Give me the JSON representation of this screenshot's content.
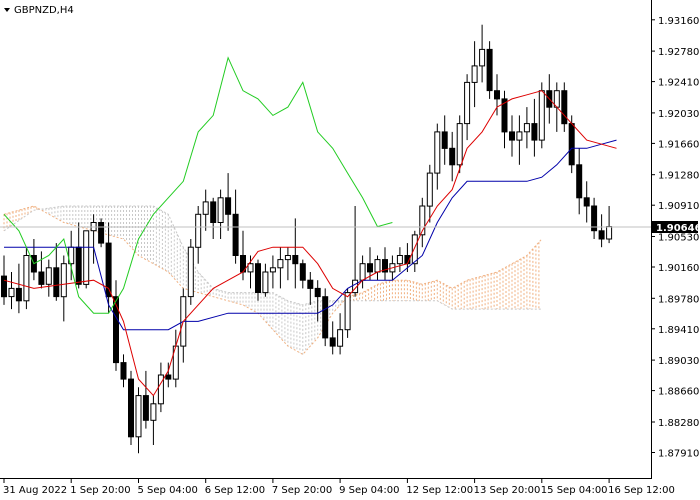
{
  "chart_data": {
    "type": "candlestick",
    "symbol_label": "GBPNZD,H4",
    "current_price_label": "1.90646",
    "current_price": 1.90646,
    "ylim": [
      1.876,
      1.934
    ],
    "y_ticks": [
      "1.93160",
      "1.92780",
      "1.92410",
      "1.92030",
      "1.91660",
      "1.91280",
      "1.90910",
      "1.90530",
      "1.90160",
      "1.89780",
      "1.89410",
      "1.89030",
      "1.88660",
      "1.88280",
      "1.87910"
    ],
    "x_ticks": [
      {
        "label": "31 Aug 2022",
        "index": 0
      },
      {
        "label": "1 Sep 20:00",
        "index": 9
      },
      {
        "label": "5 Sep 04:00",
        "index": 18
      },
      {
        "label": "6 Sep 12:00",
        "index": 27
      },
      {
        "label": "7 Sep 20:00",
        "index": 36
      },
      {
        "label": "9 Sep 04:00",
        "index": 45
      },
      {
        "label": "12 Sep 12:00",
        "index": 54
      },
      {
        "label": "13 Sep 20:00",
        "index": 63
      },
      {
        "label": "15 Sep 04:00",
        "index": 72
      },
      {
        "label": "16 Sep 12:00",
        "index": 81
      }
    ],
    "colors": {
      "bull": "#ffffff",
      "bear": "#000000",
      "tenkan": "#dd0000",
      "kijun": "#0000aa",
      "chikou": "#22cc22",
      "cloud_a": "#c8c8c8",
      "cloud_b": "#f0b080",
      "price_line": "#c0c0c0",
      "price_tag_bg": "#000000"
    },
    "candles": [
      [
        1.9005,
        1.903,
        1.897,
        1.898
      ],
      [
        1.898,
        1.901,
        1.8965,
        1.899
      ],
      [
        1.899,
        1.902,
        1.896,
        1.8975
      ],
      [
        1.8975,
        1.904,
        1.8965,
        1.903
      ],
      [
        1.903,
        1.905,
        1.9,
        1.901
      ],
      [
        1.901,
        1.9035,
        1.899,
        1.8995
      ],
      [
        1.8995,
        1.9025,
        1.898,
        1.9015
      ],
      [
        1.9015,
        1.9045,
        1.8975,
        1.898
      ],
      [
        1.898,
        1.903,
        1.895,
        1.902
      ],
      [
        1.902,
        1.906,
        1.9,
        1.904
      ],
      [
        1.904,
        1.907,
        1.899,
        1.8995
      ],
      [
        1.8995,
        1.906,
        1.899,
        1.906
      ],
      [
        1.906,
        1.908,
        1.902,
        1.907
      ],
      [
        1.907,
        1.9075,
        1.904,
        1.9045
      ],
      [
        1.9045,
        1.907,
        1.896,
        1.898
      ],
      [
        1.898,
        1.9,
        1.889,
        1.89
      ],
      [
        1.89,
        1.891,
        1.887,
        1.888
      ],
      [
        1.888,
        1.889,
        1.88,
        1.881
      ],
      [
        1.881,
        1.887,
        1.879,
        1.886
      ],
      [
        1.886,
        1.889,
        1.882,
        1.883
      ],
      [
        1.883,
        1.886,
        1.88,
        1.885
      ],
      [
        1.885,
        1.89,
        1.884,
        1.8885
      ],
      [
        1.8885,
        1.89,
        1.887,
        1.888
      ],
      [
        1.888,
        1.894,
        1.887,
        1.892
      ],
      [
        1.892,
        1.899,
        1.89,
        1.898
      ],
      [
        1.898,
        1.905,
        1.897,
        1.904
      ],
      [
        1.904,
        1.909,
        1.902,
        1.908
      ],
      [
        1.908,
        1.911,
        1.906,
        1.9095
      ],
      [
        1.9095,
        1.91,
        1.905,
        1.907
      ],
      [
        1.907,
        1.911,
        1.905,
        1.91
      ],
      [
        1.91,
        1.913,
        1.906,
        1.908
      ],
      [
        1.908,
        1.911,
        1.902,
        1.903
      ],
      [
        1.903,
        1.906,
        1.9,
        1.901
      ],
      [
        1.901,
        1.903,
        1.899,
        1.902
      ],
      [
        1.902,
        1.9025,
        1.8975,
        1.8985
      ],
      [
        1.8985,
        1.902,
        1.898,
        1.901
      ],
      [
        1.901,
        1.903,
        1.899,
        1.9015
      ],
      [
        1.9015,
        1.904,
        1.899,
        1.9025
      ],
      [
        1.9025,
        1.904,
        1.9,
        1.903
      ],
      [
        1.903,
        1.9075,
        1.899,
        1.902
      ],
      [
        1.902,
        1.9025,
        1.899,
        1.9
      ],
      [
        1.9,
        1.901,
        1.897,
        1.899
      ],
      [
        1.899,
        1.9,
        1.895,
        1.898
      ],
      [
        1.898,
        1.899,
        1.892,
        1.893
      ],
      [
        1.893,
        1.895,
        1.891,
        1.892
      ],
      [
        1.892,
        1.896,
        1.891,
        1.894
      ],
      [
        1.894,
        1.899,
        1.893,
        1.8985
      ],
      [
        1.8985,
        1.909,
        1.898,
        1.9
      ],
      [
        1.9,
        1.903,
        1.899,
        1.902
      ],
      [
        1.902,
        1.904,
        1.9,
        1.901
      ],
      [
        1.901,
        1.903,
        1.9,
        1.9025
      ],
      [
        1.9025,
        1.904,
        1.9,
        1.901
      ],
      [
        1.901,
        1.903,
        1.9,
        1.902
      ],
      [
        1.902,
        1.904,
        1.901,
        1.903
      ],
      [
        1.903,
        1.9045,
        1.901,
        1.902
      ],
      [
        1.902,
        1.906,
        1.901,
        1.9055
      ],
      [
        1.9055,
        1.91,
        1.904,
        1.909
      ],
      [
        1.909,
        1.914,
        1.907,
        1.913
      ],
      [
        1.913,
        1.919,
        1.911,
        1.918
      ],
      [
        1.918,
        1.92,
        1.914,
        1.916
      ],
      [
        1.916,
        1.918,
        1.912,
        1.914
      ],
      [
        1.914,
        1.92,
        1.913,
        1.919
      ],
      [
        1.919,
        1.925,
        1.917,
        1.924
      ],
      [
        1.924,
        1.929,
        1.921,
        1.926
      ],
      [
        1.926,
        1.931,
        1.924,
        1.928
      ],
      [
        1.928,
        1.929,
        1.922,
        1.923
      ],
      [
        1.923,
        1.925,
        1.92,
        1.922
      ],
      [
        1.922,
        1.923,
        1.916,
        1.918
      ],
      [
        1.918,
        1.92,
        1.915,
        1.917
      ],
      [
        1.917,
        1.92,
        1.914,
        1.918
      ],
      [
        1.918,
        1.921,
        1.916,
        1.919
      ],
      [
        1.919,
        1.922,
        1.915,
        1.917
      ],
      [
        1.917,
        1.924,
        1.916,
        1.923
      ],
      [
        1.923,
        1.925,
        1.919,
        1.921
      ],
      [
        1.921,
        1.924,
        1.918,
        1.923
      ],
      [
        1.923,
        1.924,
        1.918,
        1.919
      ],
      [
        1.919,
        1.92,
        1.913,
        1.914
      ],
      [
        1.914,
        1.916,
        1.908,
        1.91
      ],
      [
        1.91,
        1.912,
        1.907,
        1.909
      ],
      [
        1.909,
        1.91,
        1.905,
        1.906
      ],
      [
        1.906,
        1.908,
        1.904,
        1.905
      ],
      [
        1.905,
        1.909,
        1.9045,
        1.9065
      ]
    ],
    "tenkan": [
      [
        0,
        1.9
      ],
      [
        4,
        1.899
      ],
      [
        8,
        1.8995
      ],
      [
        12,
        1.9
      ],
      [
        14,
        1.899
      ],
      [
        16,
        1.895
      ],
      [
        18,
        1.888
      ],
      [
        20,
        1.886
      ],
      [
        22,
        1.889
      ],
      [
        24,
        1.895
      ],
      [
        26,
        1.897
      ],
      [
        28,
        1.899
      ],
      [
        30,
        1.9
      ],
      [
        32,
        1.901
      ],
      [
        34,
        1.9035
      ],
      [
        36,
        1.904
      ],
      [
        40,
        1.904
      ],
      [
        42,
        1.902
      ],
      [
        44,
        1.899
      ],
      [
        46,
        1.898
      ],
      [
        48,
        1.9
      ],
      [
        50,
        1.901
      ],
      [
        52,
        1.9015
      ],
      [
        54,
        1.902
      ],
      [
        56,
        1.906
      ],
      [
        58,
        1.909
      ],
      [
        60,
        1.911
      ],
      [
        62,
        1.916
      ],
      [
        64,
        1.918
      ],
      [
        66,
        1.921
      ],
      [
        68,
        1.922
      ],
      [
        70,
        1.9225
      ],
      [
        72,
        1.923
      ],
      [
        74,
        1.921
      ],
      [
        76,
        1.919
      ],
      [
        78,
        1.917
      ],
      [
        80,
        1.9165
      ],
      [
        82,
        1.916
      ]
    ],
    "kijun": [
      [
        0,
        1.904
      ],
      [
        4,
        1.904
      ],
      [
        8,
        1.904
      ],
      [
        12,
        1.904
      ],
      [
        14,
        1.897
      ],
      [
        16,
        1.894
      ],
      [
        18,
        1.894
      ],
      [
        22,
        1.894
      ],
      [
        24,
        1.895
      ],
      [
        26,
        1.895
      ],
      [
        30,
        1.896
      ],
      [
        34,
        1.896
      ],
      [
        38,
        1.896
      ],
      [
        42,
        1.896
      ],
      [
        44,
        1.897
      ],
      [
        46,
        1.899
      ],
      [
        48,
        1.9
      ],
      [
        52,
        1.9
      ],
      [
        56,
        1.903
      ],
      [
        58,
        1.907
      ],
      [
        60,
        1.91
      ],
      [
        62,
        1.912
      ],
      [
        66,
        1.912
      ],
      [
        70,
        1.912
      ],
      [
        72,
        1.9125
      ],
      [
        74,
        1.914
      ],
      [
        76,
        1.916
      ],
      [
        78,
        1.916
      ],
      [
        80,
        1.9165
      ],
      [
        82,
        1.917
      ]
    ],
    "chikou": [
      [
        0,
        1.908
      ],
      [
        2,
        1.906
      ],
      [
        4,
        1.902
      ],
      [
        6,
        1.903
      ],
      [
        8,
        1.905
      ],
      [
        10,
        1.898
      ],
      [
        12,
        1.896
      ],
      [
        14,
        1.896
      ],
      [
        16,
        1.899
      ],
      [
        18,
        1.905
      ],
      [
        20,
        1.908
      ],
      [
        22,
        1.91
      ],
      [
        24,
        1.912
      ],
      [
        26,
        1.918
      ],
      [
        28,
        1.92
      ],
      [
        30,
        1.927
      ],
      [
        32,
        1.923
      ],
      [
        34,
        1.922
      ],
      [
        36,
        1.92
      ],
      [
        38,
        1.921
      ],
      [
        40,
        1.924
      ],
      [
        42,
        1.918
      ],
      [
        44,
        1.916
      ],
      [
        46,
        1.913
      ],
      [
        48,
        1.91
      ],
      [
        50,
        1.9065
      ],
      [
        52,
        1.907
      ]
    ],
    "cloud": [
      [
        0,
        1.906,
        1.908
      ],
      [
        4,
        1.9085,
        1.909
      ],
      [
        8,
        1.909,
        1.907
      ],
      [
        12,
        1.909,
        1.906
      ],
      [
        16,
        1.909,
        1.905
      ],
      [
        18,
        1.909,
        1.903
      ],
      [
        20,
        1.909,
        1.902
      ],
      [
        22,
        1.908,
        1.901
      ],
      [
        24,
        1.904,
        1.899
      ],
      [
        26,
        1.901,
        1.8985
      ],
      [
        28,
        1.899,
        1.898
      ],
      [
        30,
        1.8985,
        1.8975
      ],
      [
        32,
        1.8985,
        1.897
      ],
      [
        34,
        1.8985,
        1.896
      ],
      [
        36,
        1.8985,
        1.894
      ],
      [
        38,
        1.8975,
        1.892
      ],
      [
        40,
        1.897,
        1.891
      ],
      [
        42,
        1.8975,
        1.893
      ],
      [
        44,
        1.8975,
        1.896
      ],
      [
        46,
        1.8975,
        1.898
      ],
      [
        48,
        1.8975,
        1.8985
      ],
      [
        50,
        1.8975,
        1.8995
      ],
      [
        52,
        1.8975,
        1.9
      ],
      [
        54,
        1.8975,
        1.9
      ],
      [
        56,
        1.8975,
        1.8995
      ],
      [
        58,
        1.8975,
        1.9
      ],
      [
        60,
        1.8965,
        1.899
      ],
      [
        62,
        1.8965,
        1.9
      ],
      [
        64,
        1.8965,
        1.9005
      ],
      [
        66,
        1.8965,
        1.901
      ],
      [
        68,
        1.8965,
        1.902
      ],
      [
        70,
        1.8965,
        1.903
      ],
      [
        72,
        1.8965,
        1.905
      ]
    ]
  }
}
